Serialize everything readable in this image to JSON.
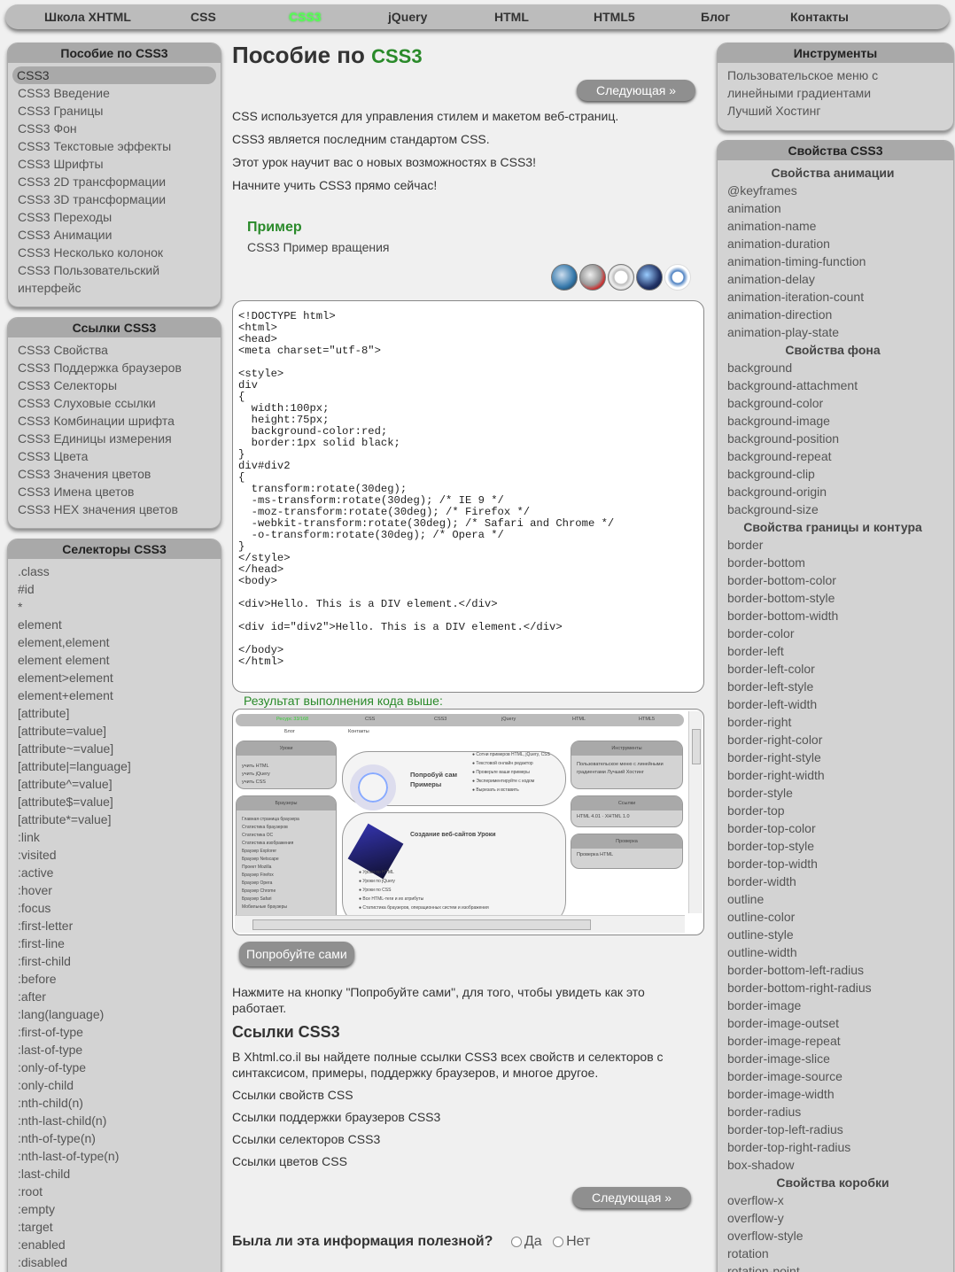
{
  "topnav": [
    "Школа XHTML",
    "CSS",
    "CSS3",
    "jQuery",
    "HTML",
    "HTML5",
    "Блог",
    "Контакты"
  ],
  "left": {
    "p1": {
      "title": "Пособие по CSS3",
      "items": [
        "CSS3",
        "CSS3 Введение",
        "CSS3 Границы",
        "CSS3 Фон",
        "CSS3 Текстовые эффекты",
        "CSS3 Шрифты",
        "CSS3 2D трансформации",
        "CSS3 3D трансформации",
        "CSS3 Переходы",
        "CSS3 Анимации",
        "CSS3 Несколько колонок",
        "CSS3 Пользовательский",
        "интерфейс"
      ]
    },
    "p2": {
      "title": "Ссылки CSS3",
      "items": [
        "CSS3 Свойства",
        "CSS3 Поддержка браузеров",
        "CSS3 Селекторы",
        "CSS3 Слуховые ссылки",
        "CSS3 Комбинации шрифта",
        "CSS3 Единицы измерения",
        "CSS3 Цвета",
        "CSS3 Значения цветов",
        "CSS3 Имена цветов",
        "CSS3 HEX значения цветов"
      ]
    },
    "p3": {
      "title": "Селекторы CSS3",
      "items": [
        ".class",
        "#id",
        "*",
        "element",
        "element,element",
        "element element",
        "element>element",
        "element+element",
        "[attribute]",
        "[attribute=value]",
        "[attribute~=value]",
        "[attribute|=language]",
        "[attribute^=value]",
        "[attribute$=value]",
        "[attribute*=value]",
        ":link",
        ":visited",
        ":active",
        ":hover",
        ":focus",
        ":first-letter",
        ":first-line",
        ":first-child",
        ":before",
        ":after",
        ":lang(language)",
        ":first-of-type",
        ":last-of-type",
        ":only-of-type",
        ":only-child",
        ":nth-child(n)",
        ":nth-last-child(n)",
        ":nth-of-type(n)",
        ":nth-last-of-type(n)",
        ":last-child",
        ":root",
        ":empty",
        ":target",
        ":enabled",
        ":disabled"
      ]
    }
  },
  "right": {
    "p1": {
      "title": "Инструменты",
      "items": [
        "Пользовательское меню с",
        "линейными градиентами",
        "Лучший Хостинг"
      ]
    },
    "p2": {
      "title": "Свойства CSS3",
      "items": [
        {
          "h": "Свойства анимации"
        },
        "@keyframes",
        "animation",
        "animation-name",
        "animation-duration",
        "animation-timing-function",
        "animation-delay",
        "animation-iteration-count",
        "animation-direction",
        "animation-play-state",
        {
          "h": "Свойства фона"
        },
        "background",
        "background-attachment",
        "background-color",
        "background-image",
        "background-position",
        "background-repeat",
        "background-clip",
        "background-origin",
        "background-size",
        {
          "h": "Свойства границы и контура"
        },
        "border",
        "border-bottom",
        "border-bottom-color",
        "border-bottom-style",
        "border-bottom-width",
        "border-color",
        "border-left",
        "border-left-color",
        "border-left-style",
        "border-left-width",
        "border-right",
        "border-right-color",
        "border-right-style",
        "border-right-width",
        "border-style",
        "border-top",
        "border-top-color",
        "border-top-style",
        "border-top-width",
        "border-width",
        "outline",
        "outline-color",
        "outline-style",
        "outline-width",
        "border-bottom-left-radius",
        "border-bottom-right-radius",
        "border-image",
        "border-image-outset",
        "border-image-repeat",
        "border-image-slice",
        "border-image-source",
        "border-image-width",
        "border-radius",
        "border-top-left-radius",
        "border-top-right-radius",
        "box-shadow",
        {
          "h": "Свойства коробки"
        },
        "overflow-x",
        "overflow-y",
        "overflow-style",
        "rotation",
        "rotation-point"
      ]
    }
  },
  "main": {
    "title_a": "Пособие по ",
    "title_b": "CSS3",
    "next": "Следующая »",
    "intro": [
      "CSS используется для управления стилем и макетом веб-страниц.",
      "CSS3 является последним стандартом CSS.",
      "Этот урок научит вас о новых возможностях в CSS3!",
      "Начните учить CSS3 прямо сейчас!"
    ],
    "example_title": "Пример",
    "example_sub": "CSS3 Пример вращения",
    "code": "<!DOCTYPE html>\n<html>\n<head>\n<meta charset=\"utf-8\">\n\n<style>\ndiv\n{\n  width:100px;\n  height:75px;\n  background-color:red;\n  border:1px solid black;\n}\ndiv#div2\n{\n  transform:rotate(30deg);\n  -ms-transform:rotate(30deg); /* IE 9 */\n  -moz-transform:rotate(30deg); /* Firefox */\n  -webkit-transform:rotate(30deg); /* Safari and Chrome */\n  -o-transform:rotate(30deg); /* Opera */\n}\n</style>\n</head>\n<body>\n\n<div>Hello. This is a DIV element.</div>\n\n<div id=\"div2\">Hello. This is a DIV element.</div>\n\n</body>\n</html>",
    "result_label": "Результат выполнения кода выше:",
    "try": "Попробуйте сами",
    "try_note": "Нажмите на кнопку \"Попробуйте сами\", для того, чтобы увидеть как это работает.",
    "refs_title": "Ссылки CSS3",
    "refs_text": "В Xhtml.co.il вы найдете полные ссылки CSS3 всех свойств и селекторов с синтаксисом, примеры, поддержку браузеров, и многое другое.",
    "refs_links": [
      "Ссылки свойств CSS",
      "Ссылки поддержки браузеров CSS3",
      "Ссылки селекторов CSS3",
      "Ссылки цветов CSS"
    ],
    "question": "Была ли эта информация полезной?",
    "yes": "Да",
    "no": "Нет"
  },
  "preview": {
    "nav": [
      "Ресурс 33/168",
      "CSS",
      "CSS3",
      "jQuery",
      "HTML",
      "HTML5",
      "Блог",
      "Контакты"
    ],
    "p_lessons": "Уроки",
    "lessons": [
      "учить HTML",
      "учить jQuery",
      "учить CSS"
    ],
    "p_browsers": "Браузеры",
    "browsers": [
      "Главная страница браузера",
      "Статистика браузеров",
      "Статистика ОС",
      "Статистика изображения",
      "Браузер Explorer",
      "Браузер Netscape",
      "Проект Mozilla",
      "Браузер Firefox",
      "Браузер Opera",
      "Браузер Chrome",
      "Браузер Safari",
      "Мобильные браузеры"
    ],
    "try_title": "Попробуй сам Примеры",
    "try_list": [
      "Сотни примеров HTML, jQuery, CSS",
      "Текстовой онлайн редактор",
      "Проверьте ваши примеры",
      "Экспериментируйте с кодом",
      "Вырезать и вставить"
    ],
    "create_title": "Создание веб-сайтов Уроки",
    "create_list": [
      "Уроки по HTML",
      "Уроки по jQuery",
      "Уроки по CSS",
      "Все HTML-теги и их атрибуты",
      "Статистика браузеров, операционных систем и изображения"
    ],
    "p_tools": "Инструменты",
    "tools": "Пользовательское меню с линейными градиентами Лучший Хостинг",
    "p_links": "Ссылки",
    "links": "HTML 4.01 · XHTML 1.0",
    "p_check": "Проверка",
    "check": "Проверка HTML"
  }
}
